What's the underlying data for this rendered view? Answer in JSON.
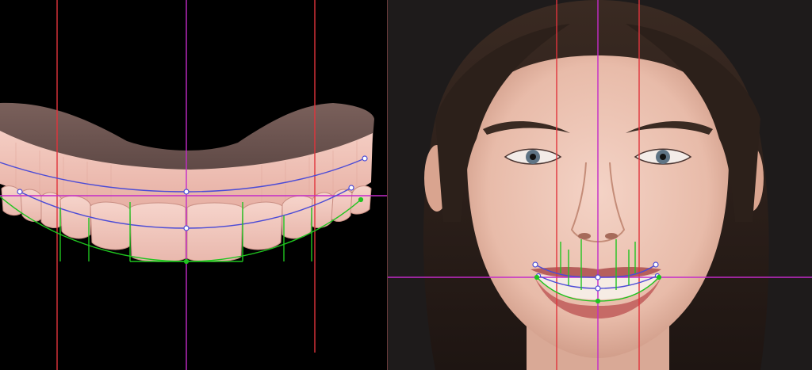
{
  "view": {
    "left_panel": "3d-dental-model-scan",
    "right_panel": "frontal-smile-photo"
  },
  "colors": {
    "guide_red": "#e0343c",
    "guide_magenta": "#c42bc9",
    "curve_blue": "#4b4bd6",
    "curve_green": "#1fc41f",
    "model_pink": "#f2c3b9",
    "model_gum": "#6e5552",
    "skin": "#ecc4b4",
    "hair": "#2e211c",
    "background": "#000000"
  },
  "guide_lines": {
    "left": {
      "vertical_red": [
        "midline-left",
        "canine-left",
        "canine-right"
      ],
      "vertical_magenta": [
        "facial-midline"
      ],
      "horizontal_magenta": [
        "incisal-plane"
      ]
    },
    "right": {
      "vertical_red": [
        "canine-left",
        "canine-right"
      ],
      "vertical_magenta": [
        "facial-midline"
      ],
      "horizontal_magenta": [
        "bipupillary-smile-plane"
      ]
    }
  },
  "curves": [
    "gingival-line",
    "incisal-curve",
    "smile-arc"
  ],
  "icons": {
    "control_point": "control-point-icon"
  }
}
